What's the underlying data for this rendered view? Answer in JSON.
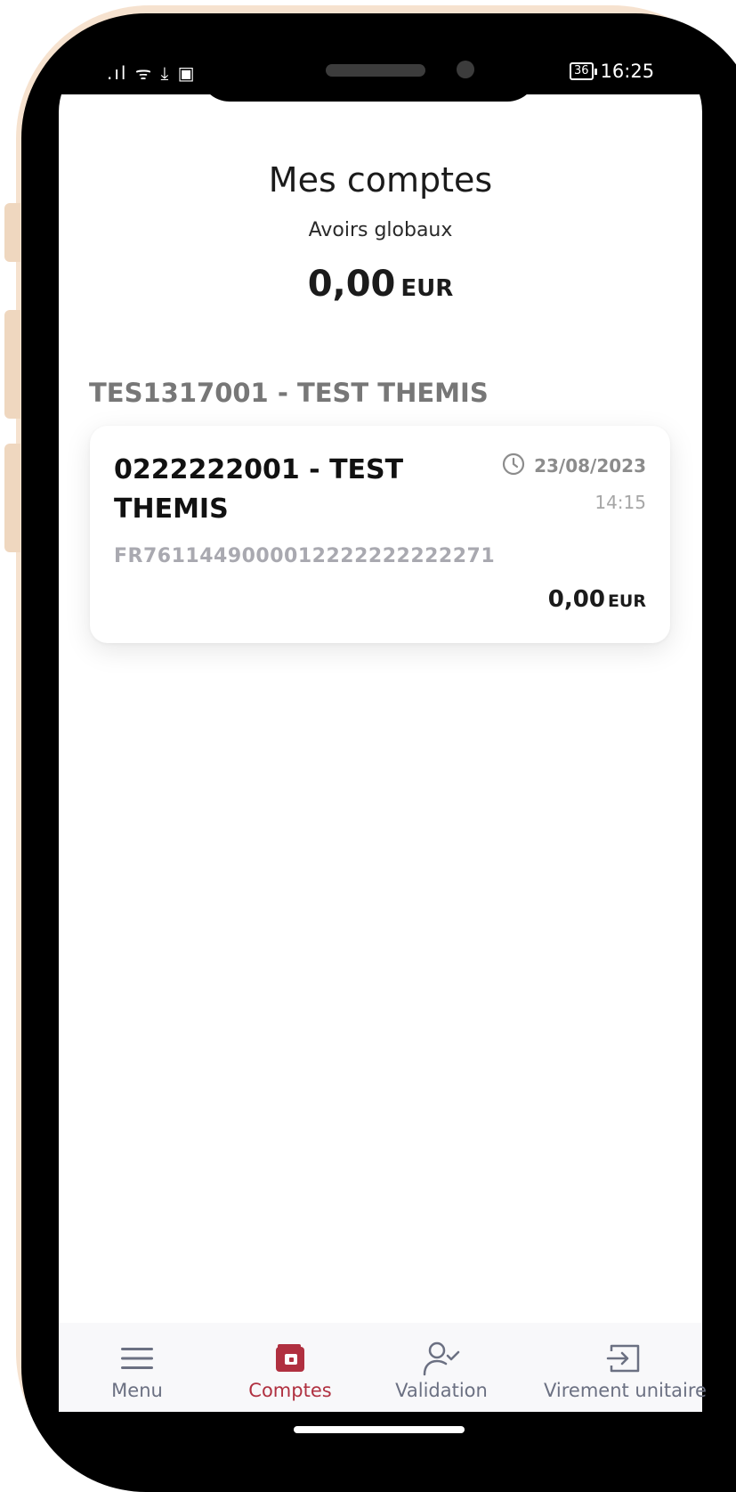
{
  "status_bar": {
    "left_icons": ".ıl ᯤ ⤓ ▣",
    "battery": "36",
    "time": "16:25"
  },
  "header": {
    "title": "Mes comptes",
    "subtitle": "Avoirs globaux",
    "total_amount": "0,00",
    "total_currency": "EUR"
  },
  "group": {
    "title": "TES1317001 - TEST THEMIS"
  },
  "account_card": {
    "name": "0222222001 - TEST THEMIS",
    "date": "23/08/2023",
    "time": "14:15",
    "iban": "FR7611449000012222222222271",
    "amount": "0,00",
    "currency": "EUR",
    "clock_icon": "clock-icon"
  },
  "nav": {
    "items": [
      {
        "label": "Menu",
        "icon": "menu-icon",
        "active": false
      },
      {
        "label": "Comptes",
        "icon": "wallet-icon",
        "active": true
      },
      {
        "label": "Validation",
        "icon": "user-check-icon",
        "active": false
      },
      {
        "label": "Virement unitaire",
        "icon": "transfer-icon",
        "active": false
      }
    ],
    "active_color": "#b03040",
    "inactive_color": "#6b7082"
  }
}
